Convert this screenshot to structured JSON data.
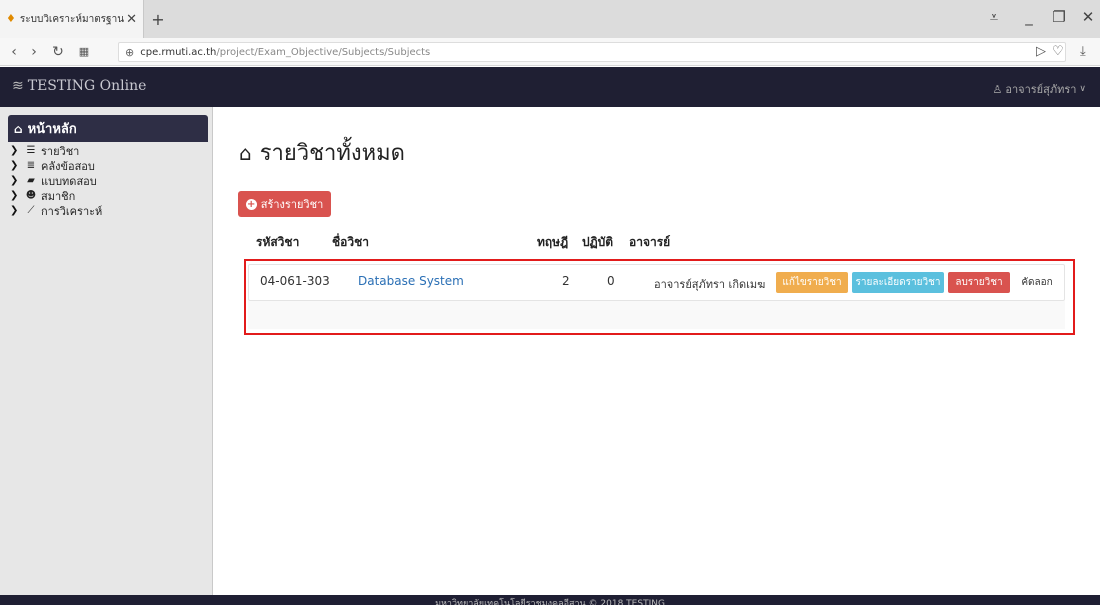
{
  "browser": {
    "tab_title": "ระบบวิเคราะห์มาตรฐานข้อสอบ",
    "tab_close": "✕",
    "new_tab": "+",
    "url_domain": "cpe.rmuti.ac.th",
    "url_path": "/project/Exam_Objective/Subjects/Subjects"
  },
  "navbar": {
    "brand": "TESTING Online",
    "user": "อาจารย์สุภัทรา"
  },
  "sidebar": {
    "home_label": "หน้าหลัก",
    "items": [
      {
        "label": "รายวิชา",
        "icon": "list-icon"
      },
      {
        "label": "คลังข้อสอบ",
        "icon": "database-icon"
      },
      {
        "label": "แบบทดสอบ",
        "icon": "book-icon"
      },
      {
        "label": "สมาชิก",
        "icon": "users-icon"
      },
      {
        "label": "การวิเคราะห์",
        "icon": "chart-icon"
      }
    ]
  },
  "main": {
    "title": "รายวิชาทั้งหมด",
    "create_button": "สร้างรายวิชา",
    "columns": [
      "รหัสวิชา",
      "ชื่อวิชา",
      "ทฤษฎี",
      "ปฏิบัติ",
      "อาจารย์"
    ],
    "rows": [
      {
        "code": "04-061-303",
        "name": "Database System",
        "theory": "2",
        "practice": "0",
        "teacher": "อาจารย์สุภัทรา เกิดเมฆ",
        "actions": {
          "edit": "แก้ไขรายวิชา",
          "detail": "รายละเอียดรายวิชา",
          "delete": "ลบรายวิชา",
          "copy": "คัดลอก"
        }
      }
    ]
  },
  "footer": {
    "text": "มหาวิทยาลัยเทคโนโลยีราชมงคลอีสาน © 2018 TESTING"
  },
  "colors": {
    "navbar": "#1f1f33",
    "danger": "#d9534f",
    "warning": "#f0ad4e",
    "info": "#5bc0de",
    "link": "#2a6fb5",
    "highlight": "#e21b1b"
  }
}
